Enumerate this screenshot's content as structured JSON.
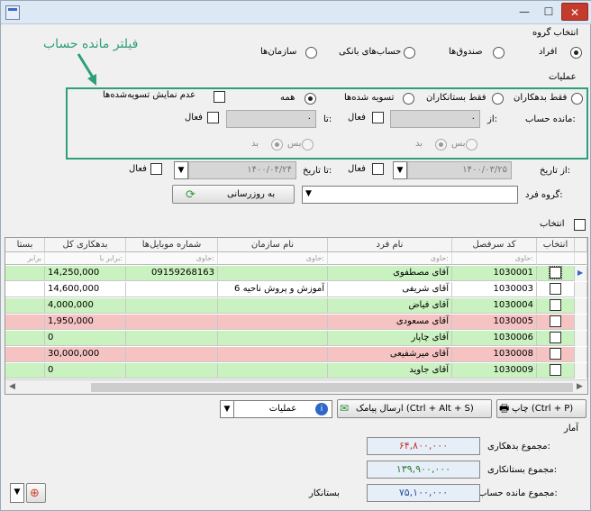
{
  "window": {
    "minimize": "—",
    "maximize": "☐",
    "close": "✕"
  },
  "annotation": {
    "label": "فیلتر مانده حساب"
  },
  "group_select": {
    "title": "انتخاب گروه",
    "options": [
      "افراد",
      "صندوق‌ها",
      "حساب‌های بانکی",
      "سازمان‌ها"
    ],
    "selected": "افراد"
  },
  "operations": {
    "title": "عملیات",
    "options": [
      "فقط بدهکاران",
      "فقط بستانکاران",
      "تسویه شده‌ها",
      "همه"
    ],
    "selected": "همه",
    "hide_settled": "عدم نمایش تسویه‌شده‌ها"
  },
  "balance": {
    "label": "مانده حساب:",
    "from": "از:",
    "to": "تا:",
    "active": "فعال",
    "from_value": "۰",
    "to_value": "۰",
    "debit": "بد",
    "credit": "بس"
  },
  "dates": {
    "from_label": "از تاریخ:",
    "from_value": "۱۴۰۰/۰۳/۲۵",
    "to_label": "تا تاریخ:",
    "to_value": "۱۴۰۰/۰۴/۲۴",
    "active": "فعال"
  },
  "person_group": {
    "label": "گروه فرد:",
    "value": ""
  },
  "refresh_button": "به روزرسانی",
  "select_all": "انتخاب",
  "grid": {
    "columns": [
      "انتخاب",
      "کد سرفصل",
      "نام فرد",
      "نام سازمان",
      "شماره موبایل‌ها",
      "بدهکاری کل",
      "بستا"
    ],
    "filters": [
      "حاوی:",
      "حاوی:",
      "حاوی:",
      "حاوی:",
      "برابر با:",
      "برابر"
    ],
    "rows": [
      {
        "code": "1030001",
        "name": "آقای مصطفوی",
        "org": "",
        "mobile": "09159268163",
        "debt": "14,250,000"
      },
      {
        "code": "1030003",
        "name": "آقای شریفی",
        "org": "آموزش و پروش ناحیه 6",
        "mobile": "",
        "debt": "14,600,000"
      },
      {
        "code": "1030004",
        "name": "آقای فیاض",
        "org": "",
        "mobile": "",
        "debt": "4,000,000"
      },
      {
        "code": "1030005",
        "name": "آقای مسعودی",
        "org": "",
        "mobile": "",
        "debt": "1,950,000"
      },
      {
        "code": "1030006",
        "name": "آقای چاپار",
        "org": "",
        "mobile": "",
        "debt": "0"
      },
      {
        "code": "1030008",
        "name": "آقای میرشفیعی",
        "org": "",
        "mobile": "",
        "debt": "30,000,000"
      },
      {
        "code": "1030009",
        "name": "آقای جاوید",
        "org": "",
        "mobile": "",
        "debt": "0"
      }
    ],
    "row_colors": [
      "#c9f2c0",
      "#ffffff",
      "#c9f2c0",
      "#f6c3c3",
      "#c9f2c0",
      "#f6c3c3",
      "#c9f2c0"
    ]
  },
  "toolbar": {
    "print": "چاپ (Ctrl + P)",
    "sms": "ارسال پیامک (Ctrl + Alt + S)",
    "operations": "عملیات"
  },
  "stats": {
    "title": "آمار",
    "total_debt_label": "مجموع بدهکاری:",
    "total_debt": "۶۴,۸۰۰,۰۰۰",
    "total_credit_label": "مجموع بستانکاری:",
    "total_credit": "۱۳۹,۹۰۰,۰۰۰",
    "total_balance_label": "مجموع مانده حساب:",
    "total_balance": "۷۵,۱۰۰,۰۰۰",
    "balance_type": "بستانکار"
  }
}
